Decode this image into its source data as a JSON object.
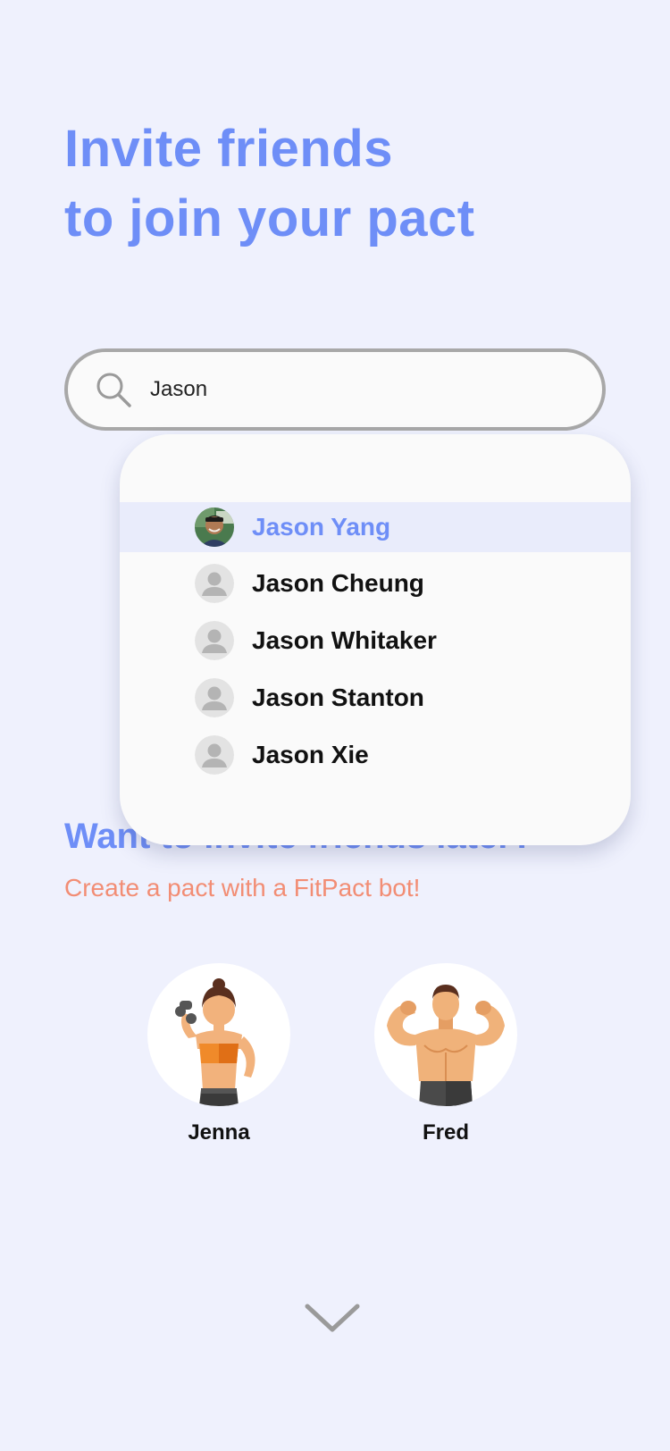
{
  "header": {
    "title_line1": "Invite friends",
    "title_line2": "to join your pact"
  },
  "search": {
    "value": "Jason",
    "icon": "search-icon"
  },
  "results": [
    {
      "name": "Jason Yang",
      "avatar": "photo",
      "selected": true
    },
    {
      "name": "Jason Cheung",
      "avatar": "default-user-icon",
      "selected": false
    },
    {
      "name": "Jason Whitaker",
      "avatar": "default-user-icon",
      "selected": false
    },
    {
      "name": "Jason Stanton",
      "avatar": "default-user-icon",
      "selected": false
    },
    {
      "name": "Jason Xie",
      "avatar": "default-user-icon",
      "selected": false
    }
  ],
  "later": {
    "heading": "Want to invite friends later?",
    "subtitle": "Create a pact with a FitPact bot!"
  },
  "bots": [
    {
      "name": "Jenna"
    },
    {
      "name": "Fred"
    }
  ],
  "colors": {
    "accent": "#6e8ef7",
    "secondary": "#f28d74",
    "background": "#eff1fd"
  }
}
